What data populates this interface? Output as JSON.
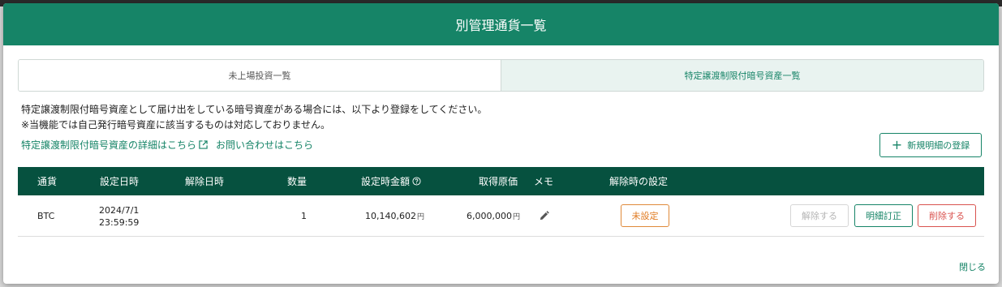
{
  "modal": {
    "title": "別管理通貨一覧",
    "close_label": "閉じる"
  },
  "tabs": [
    {
      "label": "未上場投資一覧",
      "active": false
    },
    {
      "label": "特定譲渡制限付暗号資産一覧",
      "active": true
    }
  ],
  "description": {
    "line1": "特定譲渡制限付暗号資産として届け出をしている暗号資産がある場合には、以下より登録をしてください。",
    "line2": "※当機能では自己発行暗号資産に該当するものは対応しておりません。"
  },
  "links": {
    "details": "特定譲渡制限付暗号資産の詳細はこちら",
    "contact": "お問い合わせはこちら"
  },
  "new_button": {
    "label": "新規明細の登録",
    "icon": "plus-icon"
  },
  "table": {
    "headers": {
      "currency": "通貨",
      "set_date": "設定日時",
      "release_date": "解除日時",
      "quantity": "数量",
      "set_amount": "設定時金額",
      "cost": "取得原価",
      "memo": "メモ",
      "release_setting": "解除時の設定"
    },
    "rows": [
      {
        "currency": "BTC",
        "set_date": "2024/7/1",
        "set_time": "23:59:59",
        "release_date": "",
        "quantity": "1",
        "set_amount": "10,140,602",
        "cost": "6,000,000",
        "yen": "円",
        "release_setting": "未設定",
        "release_button": "解除する",
        "correct_button": "明細訂正",
        "delete_button": "削除する"
      }
    ]
  },
  "colors": {
    "brand": "#168467",
    "table_header": "#06513f",
    "warning": "#e07a20",
    "danger": "#d9534f"
  }
}
